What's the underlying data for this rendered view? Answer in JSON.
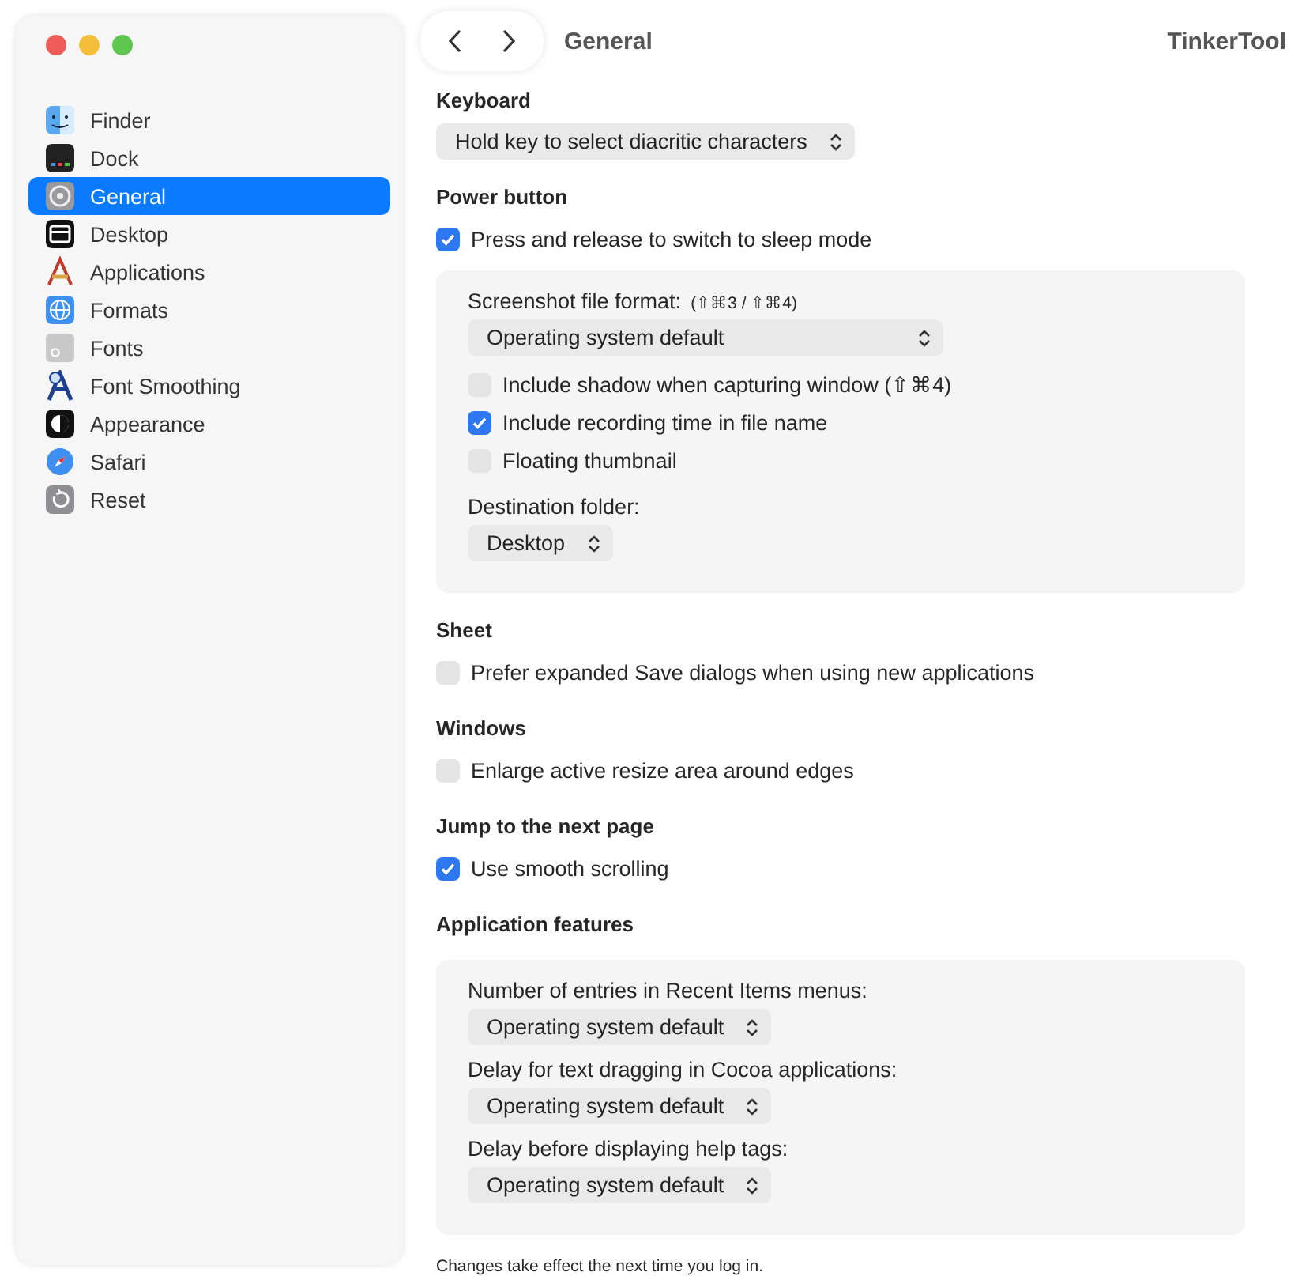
{
  "window": {
    "title": "General",
    "app": "TinkerTool"
  },
  "sidebar": {
    "items": [
      {
        "label": "Finder",
        "selected": false
      },
      {
        "label": "Dock",
        "selected": false
      },
      {
        "label": "General",
        "selected": true
      },
      {
        "label": "Desktop",
        "selected": false
      },
      {
        "label": "Applications",
        "selected": false
      },
      {
        "label": "Formats",
        "selected": false
      },
      {
        "label": "Fonts",
        "selected": false
      },
      {
        "label": "Font Smoothing",
        "selected": false
      },
      {
        "label": "Appearance",
        "selected": false
      },
      {
        "label": "Safari",
        "selected": false
      },
      {
        "label": "Reset",
        "selected": false
      }
    ]
  },
  "sections": [
    {
      "title": "Keyboard",
      "items": [
        {
          "kind": "popup",
          "value": "Hold key to select diacritic characters"
        }
      ]
    },
    {
      "title": "Power button",
      "items": [
        {
          "kind": "checkbox",
          "label": "Press and release to switch to sleep mode",
          "checked": true
        },
        {
          "kind": "group",
          "items": [
            {
              "kind": "label",
              "text": "Screenshot file format:",
              "hint": "(⇧⌘3 / ⇧⌘4)"
            },
            {
              "kind": "popup",
              "value": "Operating system default",
              "wide": true
            },
            {
              "kind": "checkbox",
              "label": "Include shadow when capturing window (⇧⌘4)",
              "checked": false
            },
            {
              "kind": "checkbox",
              "label": "Include recording time in file name",
              "checked": true
            },
            {
              "kind": "checkbox",
              "label": "Floating thumbnail",
              "checked": false
            },
            {
              "kind": "label",
              "text": "Destination folder:"
            },
            {
              "kind": "popup",
              "value": "Desktop"
            }
          ]
        }
      ]
    },
    {
      "title": "Sheet",
      "items": [
        {
          "kind": "checkbox",
          "label": "Prefer expanded Save dialogs when using new applications",
          "checked": false
        }
      ]
    },
    {
      "title": "Windows",
      "items": [
        {
          "kind": "checkbox",
          "label": "Enlarge active resize area around edges",
          "checked": false
        }
      ]
    },
    {
      "title": "Jump to the next page",
      "items": [
        {
          "kind": "checkbox",
          "label": "Use smooth scrolling",
          "checked": true
        }
      ]
    },
    {
      "title": "Application features",
      "items": [
        {
          "kind": "group",
          "items": [
            {
              "kind": "label",
              "text": "Number of entries in Recent Items menus:"
            },
            {
              "kind": "popup",
              "value": "Operating system default"
            },
            {
              "kind": "label",
              "text": "Delay for text dragging in Cocoa applications:"
            },
            {
              "kind": "popup",
              "value": "Operating system default"
            },
            {
              "kind": "label",
              "text": "Delay before displaying help tags:"
            },
            {
              "kind": "popup",
              "value": "Operating system default"
            }
          ]
        }
      ]
    }
  ],
  "footer": "Changes take effect the next time you log in."
}
